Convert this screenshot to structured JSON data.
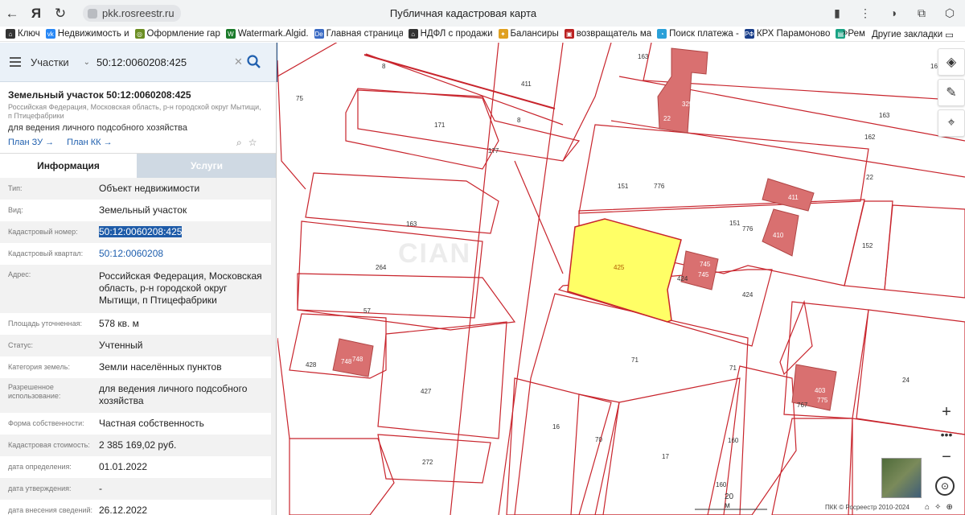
{
  "browser": {
    "url": "pkk.rosreestr.ru",
    "title": "Публичная кадастровая карта"
  },
  "bookmarks": [
    {
      "label": "Ключ",
      "icon": "house-icon"
    },
    {
      "label": "Недвижимость и",
      "icon": "vk-icon"
    },
    {
      "label": "Оформление гар",
      "icon": "globe-icon"
    },
    {
      "label": "Watermark.Algid.",
      "icon": "w-icon"
    },
    {
      "label": "Главная страница",
      "icon": "de-icon"
    },
    {
      "label": "НДФЛ с продажи",
      "icon": "house-icon"
    },
    {
      "label": "Балансиры",
      "icon": "pin-icon"
    },
    {
      "label": "возвращатель ма",
      "icon": "bag-icon"
    },
    {
      "label": "Поиск платежа -",
      "icon": "circle-icon"
    },
    {
      "label": "КРХ Парамоново",
      "icon": "rf-icon"
    },
    {
      "label": "Рем",
      "icon": "doc-icon"
    }
  ],
  "bookmarks_more": "»",
  "other_bookmarks": "Другие закладки",
  "search": {
    "type": "Участки",
    "query": "50:12:0060208:425"
  },
  "object": {
    "title": "Земельный участок 50:12:0060208:425",
    "address_short": "Российская Федерация, Московская область, р-н городской округ Мытищи, п Птицефабрики",
    "use": "для ведения личного подсобного хозяйства",
    "plan_zu": "План ЗУ",
    "plan_kk": "План КК"
  },
  "tabs": {
    "info": "Информация",
    "services": "Услуги"
  },
  "info_rows": [
    {
      "key": "Тип:",
      "value": "Объект недвижимости"
    },
    {
      "key": "Вид:",
      "value": "Земельный участок"
    },
    {
      "key": "Кадастровый номер:",
      "value": "50:12:0060208:425"
    },
    {
      "key": "Кадастровый квартал:",
      "value": "50:12:0060208"
    },
    {
      "key": "Адрес:",
      "value": "Российская Федерация, Московская область, р-н городской округ Мытищи, п Птицефабрики"
    },
    {
      "key": "Площадь уточненная:",
      "value": "578 кв. м"
    },
    {
      "key": "Статус:",
      "value": "Учтенный"
    },
    {
      "key": "Категория земель:",
      "value": "Земли населённых пунктов"
    },
    {
      "key": "Разрешенное использование:",
      "value": "для ведения личного подсобного хозяйства"
    },
    {
      "key": "Форма собственности:",
      "value": "Частная собственность"
    },
    {
      "key": "Кадастровая стоимость:",
      "value": "2 385 169,02 руб."
    },
    {
      "key": "дата определения:",
      "value": "01.01.2022"
    },
    {
      "key": "дата утверждения:",
      "value": "-"
    },
    {
      "key": "дата внесения сведений:",
      "value": "26.12.2022"
    }
  ],
  "map": {
    "scale_label": "20 м",
    "copyright": "ПКК © Росреестр 2010-2024",
    "watermark": "CIAN",
    "labels": [
      "8",
      "411",
      "75",
      "171",
      "8",
      "177",
      "163",
      "264",
      "57",
      "428",
      "427",
      "272",
      "16",
      "70",
      "17",
      "71",
      "160",
      "160",
      "151",
      "776",
      "151",
      "776",
      "410",
      "411",
      "424",
      "745",
      "745",
      "424",
      "403",
      "775",
      "767",
      "24",
      "152",
      "22",
      "162",
      "163",
      "163",
      "325",
      "162",
      "22",
      "325",
      "748",
      "748",
      "71",
      "425"
    ]
  },
  "colors": {
    "parcel_line": "#c8242c",
    "building_fill": "#d97070",
    "selected_fill": "#ffff66",
    "panel_header": "#eaf1f8",
    "accent": "#1f5fae"
  }
}
